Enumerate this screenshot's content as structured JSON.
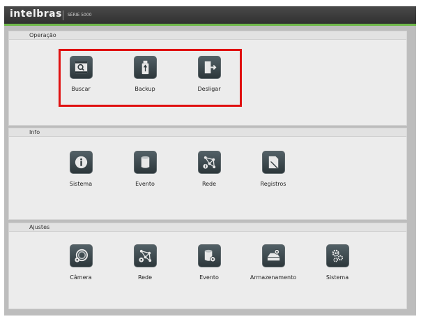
{
  "header": {
    "brand": "intelbras",
    "series": "SÉRIE 5000"
  },
  "colors": {
    "accent": "#6fb84a",
    "highlight": "#e01010",
    "icon_bg": "#3a4549"
  },
  "sections": {
    "operacao": {
      "title": "Operação",
      "items": [
        {
          "label": "Buscar",
          "icon": "search-film-icon"
        },
        {
          "label": "Backup",
          "icon": "usb-drive-icon"
        },
        {
          "label": "Desligar",
          "icon": "exit-door-icon"
        }
      ]
    },
    "info": {
      "title": "Info",
      "items": [
        {
          "label": "Sistema",
          "icon": "info-icon"
        },
        {
          "label": "Evento",
          "icon": "event-sensor-icon"
        },
        {
          "label": "Rede",
          "icon": "network-info-icon"
        },
        {
          "label": "Registros",
          "icon": "log-pencil-icon"
        }
      ]
    },
    "ajustes": {
      "title": "Ajustes",
      "items": [
        {
          "label": "Câmera",
          "icon": "camera-settings-icon"
        },
        {
          "label": "Rede",
          "icon": "network-settings-icon"
        },
        {
          "label": "Evento",
          "icon": "event-settings-icon"
        },
        {
          "label": "Armazenamento",
          "icon": "storage-settings-icon"
        },
        {
          "label": "Sistema",
          "icon": "system-gears-icon"
        }
      ]
    }
  }
}
